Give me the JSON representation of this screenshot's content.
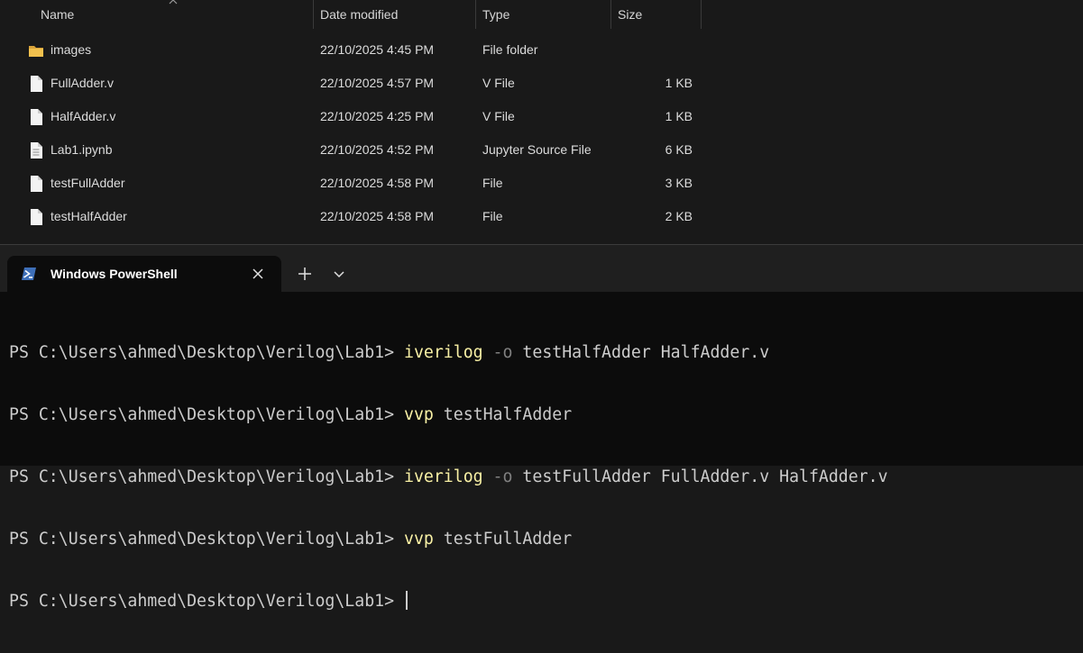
{
  "explorer": {
    "columns": {
      "name": "Name",
      "date_modified": "Date modified",
      "type": "Type",
      "size": "Size"
    },
    "files": [
      {
        "icon": "folder-icon",
        "name": "images",
        "date": "22/10/2025 4:45 PM",
        "type": "File folder",
        "size": ""
      },
      {
        "icon": "file-icon",
        "name": "FullAdder.v",
        "date": "22/10/2025 4:57 PM",
        "type": "V File",
        "size": "1 KB"
      },
      {
        "icon": "file-icon",
        "name": "HalfAdder.v",
        "date": "22/10/2025 4:25 PM",
        "type": "V File",
        "size": "1 KB"
      },
      {
        "icon": "notebook-file-icon",
        "name": "Lab1.ipynb",
        "date": "22/10/2025 4:52 PM",
        "type": "Jupyter Source File",
        "size": "6 KB"
      },
      {
        "icon": "file-icon",
        "name": "testFullAdder",
        "date": "22/10/2025 4:58 PM",
        "type": "File",
        "size": "3 KB"
      },
      {
        "icon": "file-icon",
        "name": "testHalfAdder",
        "date": "22/10/2025 4:58 PM",
        "type": "File",
        "size": "2 KB"
      }
    ]
  },
  "terminal": {
    "tab_title": "Windows PowerShell",
    "lines": [
      {
        "prompt": "PS C:\\Users\\ahmed\\Desktop\\Verilog\\Lab1> ",
        "cmd": "iverilog",
        "flag": " -o",
        "args": " testHalfAdder HalfAdder.v"
      },
      {
        "prompt": "PS C:\\Users\\ahmed\\Desktop\\Verilog\\Lab1> ",
        "cmd": "vvp",
        "flag": "",
        "args": " testHalfAdder"
      },
      {
        "prompt": "PS C:\\Users\\ahmed\\Desktop\\Verilog\\Lab1> ",
        "cmd": "iverilog",
        "flag": " -o",
        "args": " testFullAdder FullAdder.v HalfAdder.v"
      },
      {
        "prompt": "PS C:\\Users\\ahmed\\Desktop\\Verilog\\Lab1> ",
        "cmd": "vvp",
        "flag": "",
        "args": " testFullAdder"
      }
    ],
    "current_prompt": "PS C:\\Users\\ahmed\\Desktop\\Verilog\\Lab1> "
  },
  "colors": {
    "explorer_bg": "#191919",
    "terminal_bg": "#0c0c0c",
    "command": "#f9f1a5",
    "flag": "#808080",
    "folder": "#f2c14e"
  }
}
